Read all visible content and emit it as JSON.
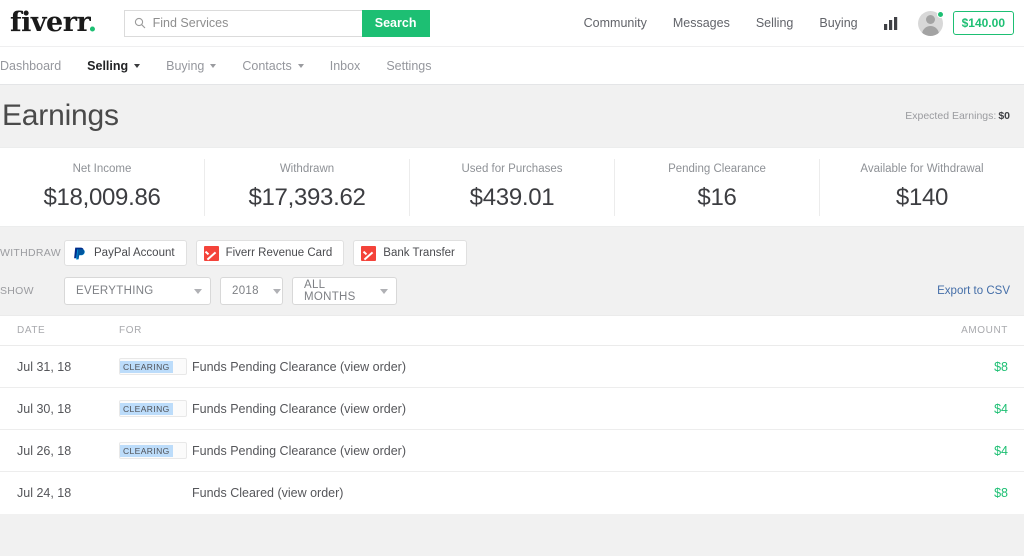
{
  "header": {
    "logo": "fiverr",
    "logo_dot": ".",
    "search": {
      "placeholder": "Find Services",
      "value": "",
      "icon": "search-icon",
      "button_label": "Search"
    },
    "nav": [
      {
        "label": "Community"
      },
      {
        "label": "Messages"
      },
      {
        "label": "Selling"
      },
      {
        "label": "Buying"
      }
    ],
    "analytics_icon": "bar-chart-icon",
    "avatar": "user-avatar",
    "online_status": "online",
    "balance": "$140.00",
    "balance_color": "#1dbf73"
  },
  "subnav": [
    {
      "label": "Dashboard",
      "active": false,
      "caret": false
    },
    {
      "label": "Selling",
      "active": true,
      "caret": true
    },
    {
      "label": "Buying",
      "active": false,
      "caret": true
    },
    {
      "label": "Contacts",
      "active": false,
      "caret": true
    },
    {
      "label": "Inbox",
      "active": false,
      "caret": false
    },
    {
      "label": "Settings",
      "active": false,
      "caret": false
    }
  ],
  "page": {
    "title": "Earnings",
    "expected_label": "Expected Earnings:",
    "expected_value": "$0"
  },
  "stats": [
    {
      "label": "Net Income",
      "value": "$18,009.86"
    },
    {
      "label": "Withdrawn",
      "value": "$17,393.62"
    },
    {
      "label": "Used for Purchases",
      "value": "$439.01"
    },
    {
      "label": "Pending Clearance",
      "value": "$16"
    },
    {
      "label": "Available for Withdrawal",
      "value": "$140"
    }
  ],
  "withdraw": {
    "label": "WITHDRAW",
    "options": [
      {
        "label": "PayPal Account",
        "icon": "paypal-icon"
      },
      {
        "label": "Fiverr Revenue Card",
        "icon": "fiverr-card-icon"
      },
      {
        "label": "Bank Transfer",
        "icon": "fiverr-card-icon"
      }
    ]
  },
  "show": {
    "label": "SHOW",
    "filter_type": "EVERYTHING",
    "filter_year": "2018",
    "filter_month": "ALL MONTHS",
    "export_label": "Export to CSV"
  },
  "table": {
    "columns": {
      "date": "DATE",
      "for": "FOR",
      "amount": "AMOUNT"
    },
    "rows": [
      {
        "date": "Jul 31, 18",
        "badge": "CLEARING",
        "for": "Funds Pending Clearance (view order)",
        "amount": "$8"
      },
      {
        "date": "Jul 30, 18",
        "badge": "CLEARING",
        "for": "Funds Pending Clearance (view order)",
        "amount": "$4"
      },
      {
        "date": "Jul 26, 18",
        "badge": "CLEARING",
        "for": "Funds Pending Clearance (view order)",
        "amount": "$4"
      },
      {
        "date": "Jul 24, 18",
        "badge": "",
        "for": "Funds Cleared (view order)",
        "amount": "$8"
      }
    ]
  }
}
